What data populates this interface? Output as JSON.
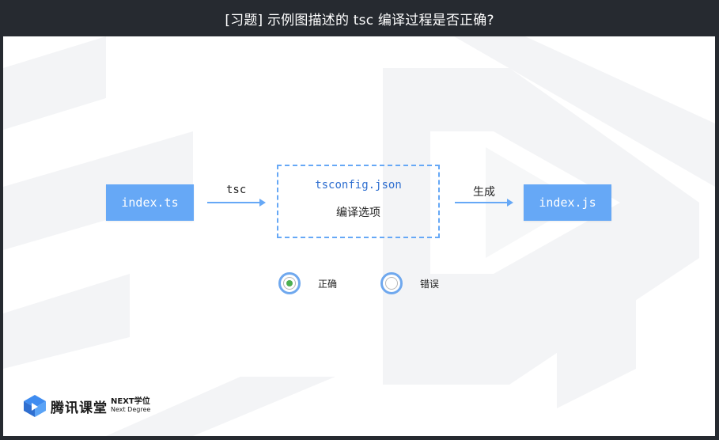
{
  "title": "[习题] 示例图描述的 tsc 编译过程是否正确?",
  "diagram": {
    "source_file": "index.ts",
    "arrow1_label": "tsc",
    "config_name": "tsconfig.json",
    "config_sub": "编译选项",
    "arrow2_label": "生成",
    "output_file": "index.js"
  },
  "options": [
    {
      "label": "正确",
      "selected": true
    },
    {
      "label": "错误",
      "selected": false
    }
  ],
  "brand": {
    "name": "腾讯课堂",
    "next": "NEXT学位",
    "degree": "Next Degree"
  },
  "colors": {
    "accent": "#66a8f6",
    "config_text": "#2f6fd0",
    "selected_dot": "#4caf50"
  }
}
